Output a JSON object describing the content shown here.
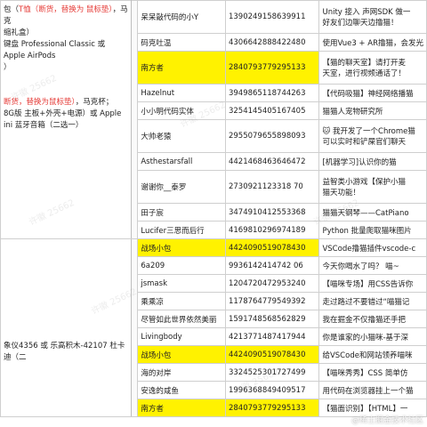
{
  "left_notes": [
    {
      "parts": [
        {
          "t": "包（",
          "red": false
        },
        {
          "t": "T恤（断货，替换为 鼠标垫）",
          "red": true
        },
        {
          "t": "，马克",
          "red": false
        }
      ]
    },
    {
      "parts": [
        {
          "t": "缩礼盒）",
          "red": false
        }
      ]
    },
    {
      "parts": [
        {
          "t": "键盘 Professional Classic 或 Apple AirPods",
          "red": false
        }
      ]
    },
    {
      "parts": [
        {
          "t": "）",
          "red": false
        }
      ]
    },
    {
      "parts": [
        {
          "t": "断货，替换为鼠标垫）",
          "red": true
        },
        {
          "t": "，马克杯；",
          "red": false
        }
      ]
    },
    {
      "parts": [
        {
          "t": "8G版 主板+外壳+电源）或 Apple",
          "red": false
        }
      ]
    },
    {
      "parts": [
        {
          "t": "ini 蓝牙音箱（二选一）",
          "red": false
        }
      ]
    },
    {
      "parts": [
        {
          "t": "象仪4356 或 乐高积木-42107 杜卡迪（二",
          "red": false
        }
      ]
    }
  ],
  "rows": [
    {
      "name": "呆呆敲代码的小Y",
      "id": "1390249158639911",
      "desc": "Unity 接入 声网SDK 做一",
      "desc2": "好友们边聊天边撸猫！",
      "yellow": false
    },
    {
      "name": "码克吐温",
      "id": "4306642888422480",
      "desc": "使用Vue3 + AR撸猫，会发光",
      "yellow": false
    },
    {
      "name": "南方者",
      "id": "2840793779295133",
      "desc": "【猫的聊天室】请打开麦",
      "desc2": "天室，进行视频通话了！",
      "yellow": true
    },
    {
      "name": "Hazelnut",
      "id": "3949865118744263",
      "desc": "【代码吸猫】神经网络播猫",
      "yellow": false
    },
    {
      "name": "小小明代码实体",
      "id": "3254145405167405",
      "desc": "猫猫人宠物研究所",
      "yellow": false
    },
    {
      "name": "大帅老猿",
      "id": "2955079655898093",
      "desc": "🐱 我开发了一个Chrome猫",
      "desc2": "可以实时和铲屎官们聊天",
      "yellow": false
    },
    {
      "name": "Asthestarsfall",
      "id": "4421468463646472",
      "desc": "[机器学习]认识你的猫",
      "yellow": false
    },
    {
      "name": "谢谢你__泰罗",
      "id": "2730921123318 70",
      "desc": "益智类小游戏【保护小猫",
      "desc2": "猫天功能！",
      "yellow": false
    },
    {
      "name": "田子宸",
      "id": "3474910412553368",
      "desc": "猫猫天钢琴——CatPiano",
      "yellow": false
    },
    {
      "name": "Lucifer三思而后行",
      "id": "4169810296974189",
      "desc": "Python 批量爬取猫咪图片",
      "yellow": false
    },
    {
      "name": "战场小包",
      "id": "4424090519078430",
      "desc": "VSCode撸猫插件vscode-c",
      "yellow": true
    },
    {
      "name": "6a209",
      "id": "9936142414742 06",
      "desc": "今天你喝水了吗？ 喵~",
      "yellow": false
    },
    {
      "name": "jsmask",
      "id": "1204720472953240",
      "desc": "【喵咪专场】用CSS告诉你",
      "yellow": false
    },
    {
      "name": "乘乘凉",
      "id": "1178764779549392",
      "desc": "走过路过不要错过“喵猫记",
      "yellow": false
    },
    {
      "name": "尽管如此世界依然美丽",
      "id": "1591748568562829",
      "desc": "我在掘金不仅撸猫还手把",
      "yellow": false
    },
    {
      "name": "Livingbody",
      "id": "4213771487417944",
      "desc": "你是谁家的小猫咪-基于深",
      "desc2": "",
      "yellow": false
    },
    {
      "name": "战场小包",
      "id": "4424090519078430",
      "desc": "给VSCode和网站领养喵咪",
      "yellow": true
    },
    {
      "name": "海的对岸",
      "id": "3324525301727499",
      "desc": "【喵咪秀秀】CSS 简单仿",
      "yellow": false
    },
    {
      "name": "安逸的咸鱼",
      "id": "1996368849409517",
      "desc": "用代码在浏览器挂上一个猫",
      "yellow": false
    },
    {
      "name": "南方者",
      "id": "2840793779295133",
      "desc": "【猫面识别】【HTML】一",
      "yellow": true
    }
  ],
  "watermark": "许徽 25662",
  "footer_watermark": "@稀土掘金技术社区"
}
